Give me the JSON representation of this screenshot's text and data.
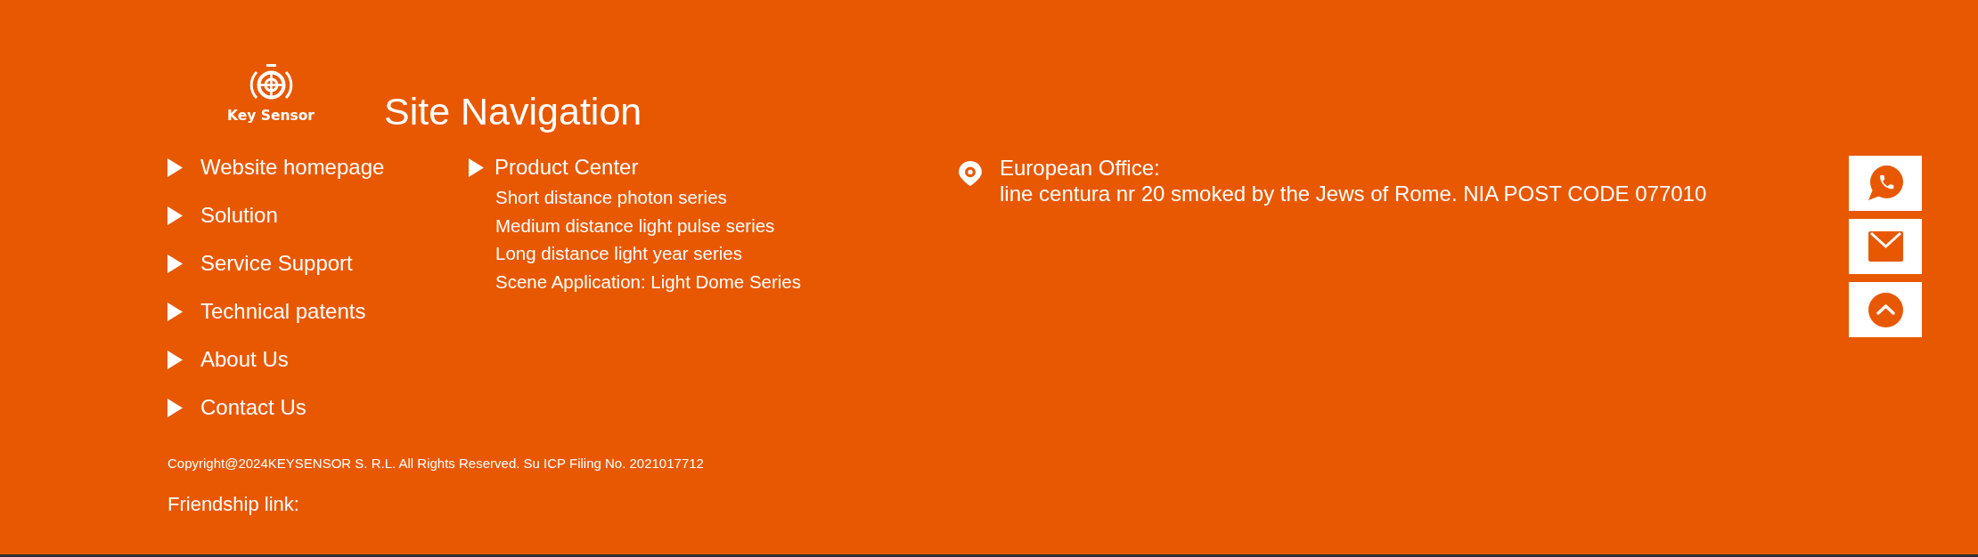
{
  "logo": {
    "text": "Key Sensor"
  },
  "title": "Site Navigation",
  "nav_links": [
    "Website homepage",
    "Solution",
    "Service Support",
    "Technical patents",
    "About Us",
    "Contact Us"
  ],
  "product_center": {
    "label": "Product Center",
    "items": [
      "Short distance photon series",
      "Medium distance light pulse series",
      "Long distance light year series",
      "Scene Application: Light Dome Series"
    ]
  },
  "office": {
    "title": "European Office:",
    "address": "line centura nr 20 smoked by the Jews of Rome. NIA POST CODE 077010"
  },
  "side_buttons": [
    {
      "kind": "phone"
    },
    {
      "kind": "mail"
    },
    {
      "kind": "top"
    }
  ],
  "copyright": "Copyright@2024KEYSENSOR S. R.L. All Rights Reserved. Su ICP Filing No. 2021017712",
  "friendship_link": "Friendship link:"
}
